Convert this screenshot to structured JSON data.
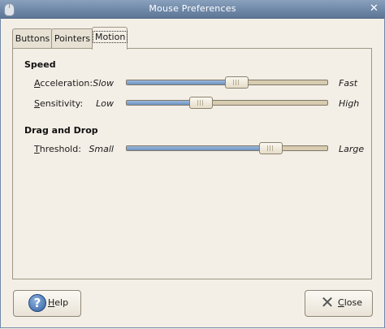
{
  "window": {
    "title": "Mouse Preferences"
  },
  "tabs": [
    {
      "label": "Buttons",
      "active": false
    },
    {
      "label": "Pointers",
      "active": false
    },
    {
      "label": "Motion",
      "active": true
    }
  ],
  "speed": {
    "heading": "Speed",
    "acceleration": {
      "mnemonic": "A",
      "rest": "cceleration:",
      "min_label": "Slow",
      "max_label": "Fast",
      "value_fraction": 0.55
    },
    "sensitivity": {
      "mnemonic": "S",
      "rest": "ensitivity:",
      "min_label": "Low",
      "max_label": "High",
      "value_fraction": 0.35
    }
  },
  "drag_and_drop": {
    "heading": "Drag and Drop",
    "threshold": {
      "mnemonic": "T",
      "rest": "hreshold:",
      "min_label": "Small",
      "max_label": "Large",
      "value_fraction": 0.74
    }
  },
  "buttons": {
    "help": {
      "mnemonic": "H",
      "rest": "elp",
      "icon": "help-icon"
    },
    "close": {
      "mnemonic": "C",
      "rest": "lose",
      "icon": "close-icon"
    }
  },
  "colors": {
    "titlebar": "#6f88a8",
    "slider_fill": "#6e92c2",
    "slider_track": "#d8ccb0",
    "background": "#f4efe6"
  }
}
